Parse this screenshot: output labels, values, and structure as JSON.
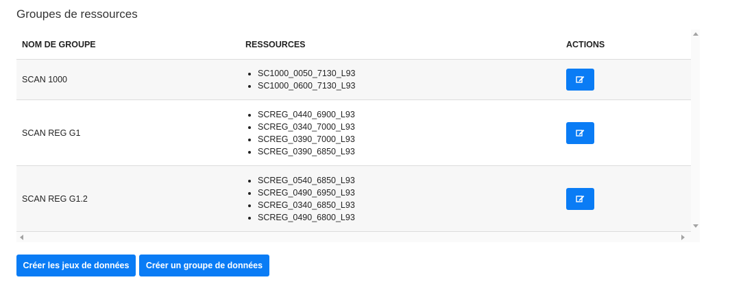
{
  "page": {
    "title": "Groupes de ressources"
  },
  "table": {
    "headers": [
      "NOM DE GROUPE",
      "RESSOURCES",
      "ACTIONS"
    ],
    "rows": [
      {
        "name": "SCAN 1000",
        "resources": [
          "SC1000_0050_7130_L93",
          "SC1000_0600_7130_L93"
        ],
        "action_icon": "edit-icon"
      },
      {
        "name": "SCAN REG G1",
        "resources": [
          "SCREG_0440_6900_L93",
          "SCREG_0340_7000_L93",
          "SCREG_0390_7000_L93",
          "SCREG_0390_6850_L93"
        ],
        "action_icon": "edit-icon"
      },
      {
        "name": "SCAN REG G1.2",
        "resources": [
          "SCREG_0540_6850_L93",
          "SCREG_0490_6950_L93",
          "SCREG_0340_6850_L93",
          "SCREG_0490_6800_L93"
        ],
        "action_icon": "edit-icon"
      }
    ]
  },
  "footer": {
    "create_datasets_label": "Créer les jeux de données",
    "create_group_label": "Créer un groupe de données"
  },
  "colors": {
    "accent": "#0a7cf5",
    "row_alt": "#f7f7f7"
  }
}
